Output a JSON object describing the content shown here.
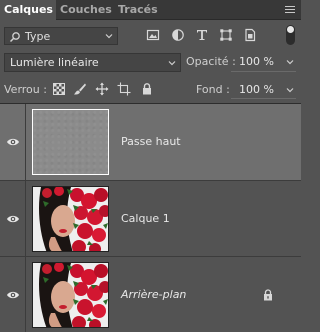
{
  "tabs": [
    {
      "label": "Calques",
      "active": true
    },
    {
      "label": "Couches",
      "active": false
    },
    {
      "label": "Tracés",
      "active": false
    }
  ],
  "filter": {
    "kind_label": "Type",
    "icons": [
      "image-filter-icon",
      "adjustment-filter-icon",
      "type-filter-icon",
      "shape-filter-icon",
      "smart-object-filter-icon"
    ]
  },
  "blend": {
    "mode": "Lumière linéaire",
    "opacity_label": "Opacité :",
    "opacity_value": "100 %"
  },
  "locks": {
    "label": "Verrou :",
    "fill_label": "Fond :",
    "fill_value": "100 %",
    "icons": [
      "lock-transparent-pixels-icon",
      "lock-image-pixels-icon",
      "lock-position-icon",
      "lock-artboard-icon",
      "lock-all-icon"
    ]
  },
  "layers": [
    {
      "name": "Passe haut",
      "selected": true,
      "visible": true,
      "thumb": "gray",
      "italic": false,
      "locked": false
    },
    {
      "name": "Calque 1",
      "selected": false,
      "visible": true,
      "thumb": "photo",
      "italic": false,
      "locked": false
    },
    {
      "name": "Arrière-plan",
      "selected": false,
      "visible": true,
      "thumb": "photo",
      "italic": true,
      "locked": true
    }
  ],
  "colors": {
    "panel_bg": "#535353",
    "selected_bg": "#6f6f6f",
    "tab_bar": "#383838",
    "text": "#e8e8e8"
  }
}
